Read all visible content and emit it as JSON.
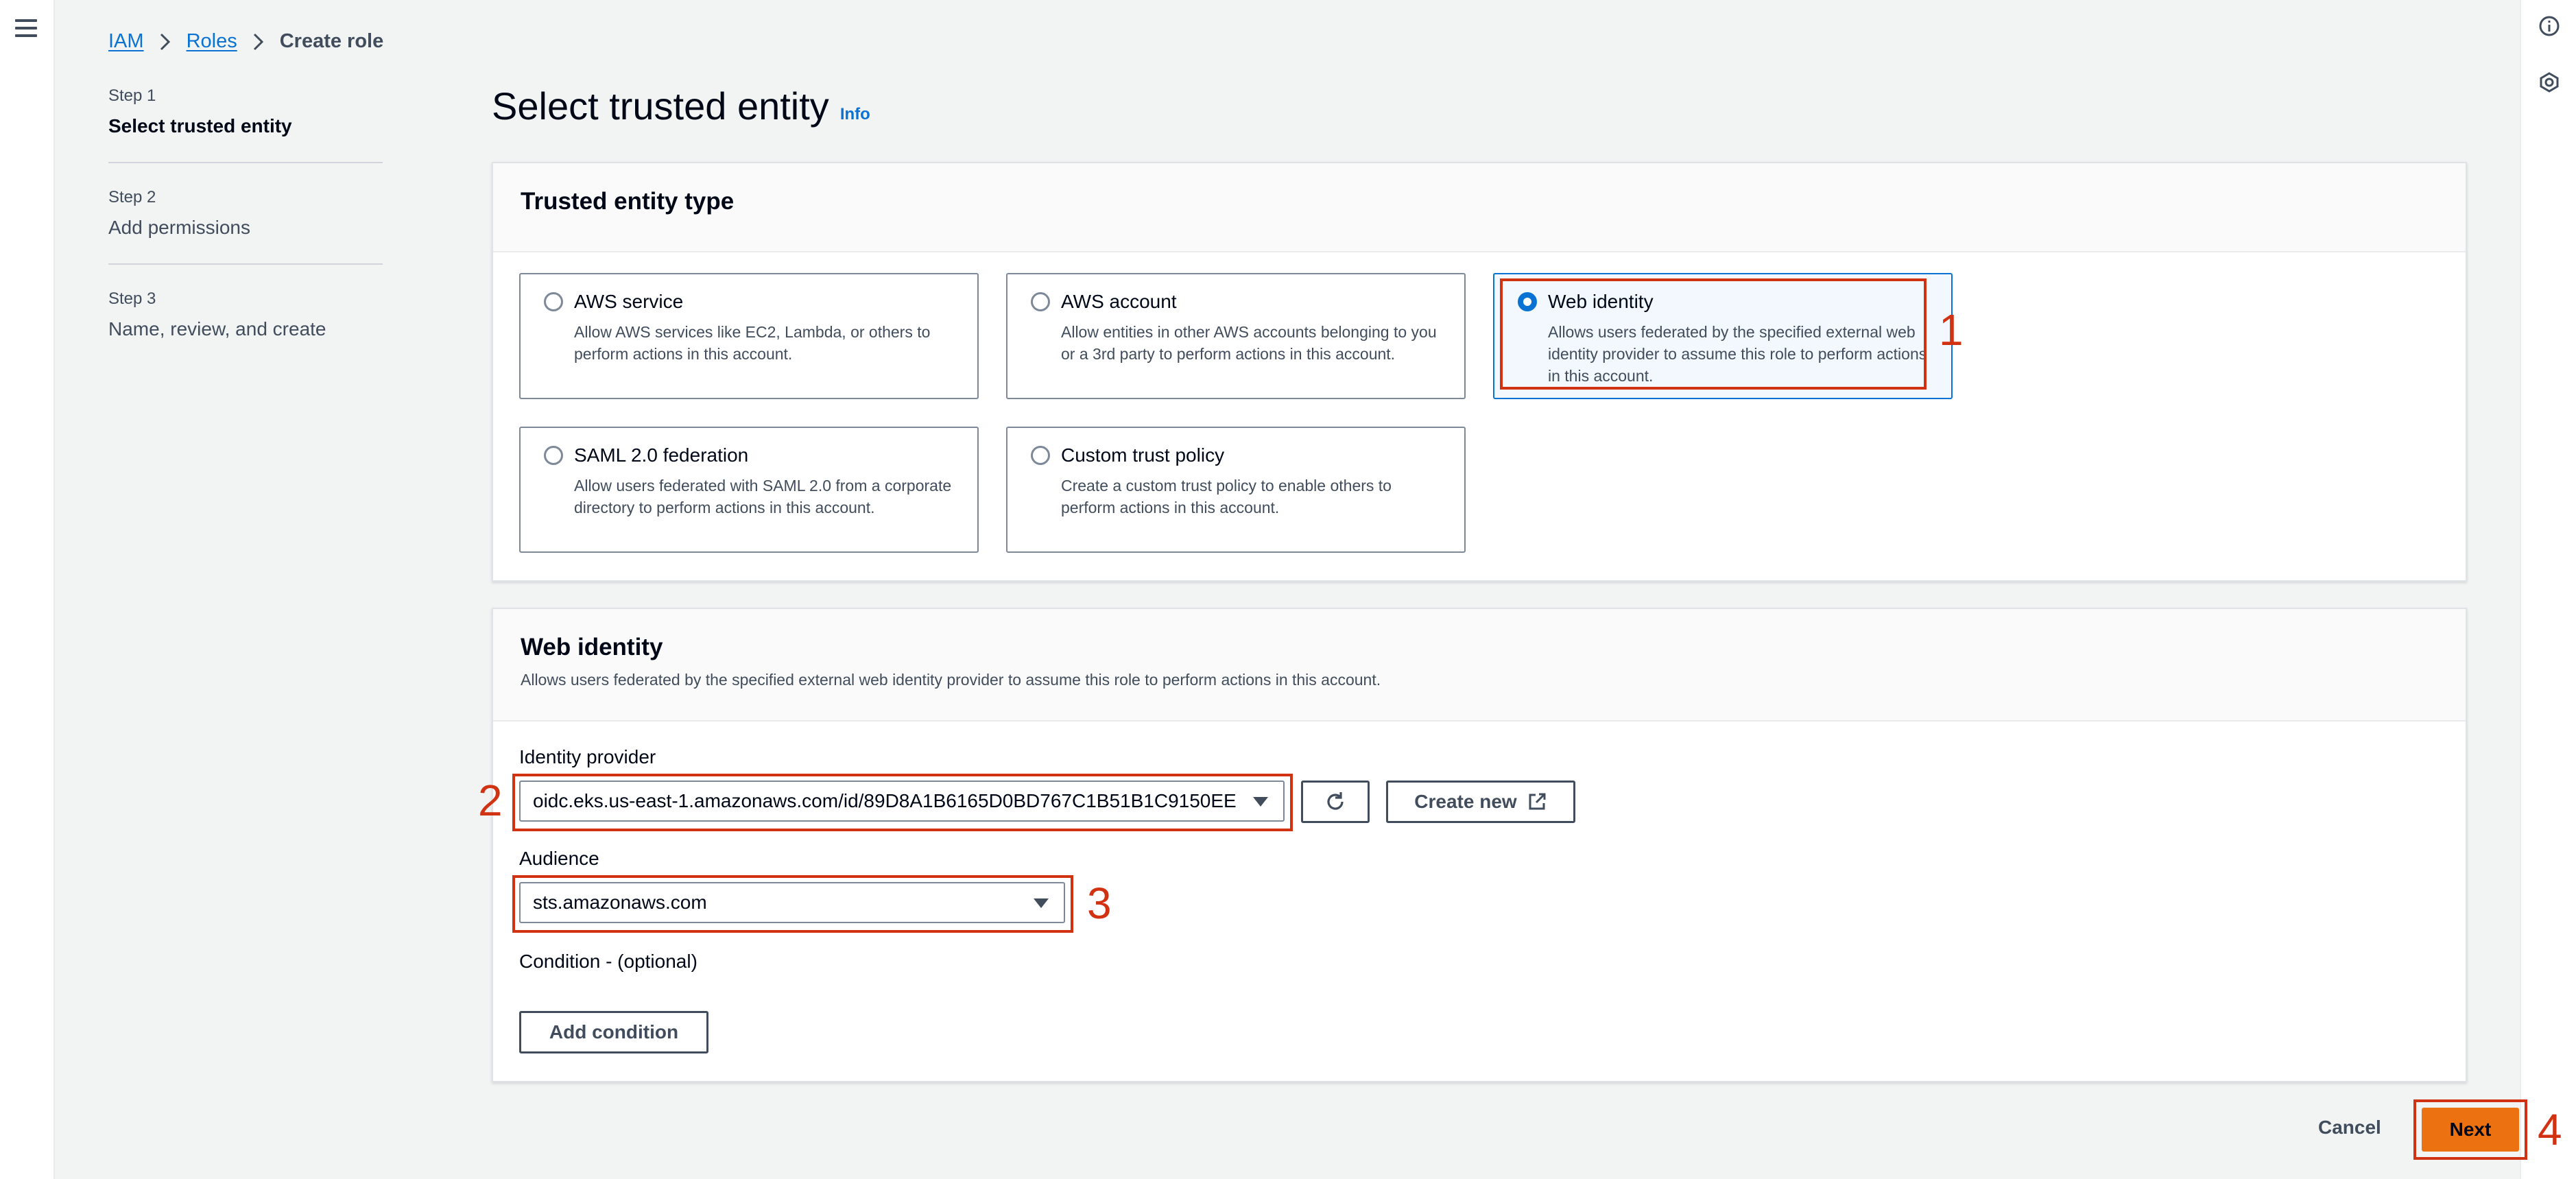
{
  "breadcrumb": {
    "iam": "IAM",
    "roles": "Roles",
    "current": "Create role"
  },
  "steps": [
    {
      "num": "Step 1",
      "title": "Select trusted entity",
      "active": true
    },
    {
      "num": "Step 2",
      "title": "Add permissions",
      "active": false
    },
    {
      "num": "Step 3",
      "title": "Name, review, and create",
      "active": false
    }
  ],
  "page": {
    "title": "Select trusted entity",
    "info": "Info"
  },
  "entity_types": {
    "title": "Trusted entity type",
    "options": [
      {
        "title": "AWS service",
        "desc": "Allow AWS services like EC2, Lambda, or others to perform actions in this account.",
        "selected": false
      },
      {
        "title": "AWS account",
        "desc": "Allow entities in other AWS accounts belonging to you or a 3rd party to perform actions in this account.",
        "selected": false
      },
      {
        "title": "Web identity",
        "desc": "Allows users federated by the specified external web identity provider to assume this role to perform actions in this account.",
        "selected": true
      },
      {
        "title": "SAML 2.0 federation",
        "desc": "Allow users federated with SAML 2.0 from a corporate directory to perform actions in this account.",
        "selected": false
      },
      {
        "title": "Custom trust policy",
        "desc": "Create a custom trust policy to enable others to perform actions in this account.",
        "selected": false
      }
    ]
  },
  "web_identity": {
    "title": "Web identity",
    "desc": "Allows users federated by the specified external web identity provider to assume this role to perform actions in this account.",
    "provider_label": "Identity provider",
    "provider_value": "oidc.eks.us-east-1.amazonaws.com/id/89D8A1B6165D0BD767C1B51B1C9150EE",
    "create_new": "Create new",
    "audience_label": "Audience",
    "audience_value": "sts.amazonaws.com",
    "condition_label": "Condition - (optional)",
    "add_condition": "Add condition"
  },
  "footer": {
    "cancel": "Cancel",
    "next": "Next"
  },
  "annotations": [
    "1",
    "2",
    "3",
    "4"
  ],
  "colors": {
    "accent": "#0972d3",
    "primary_button": "#ec7211",
    "annotation": "#d13212"
  }
}
